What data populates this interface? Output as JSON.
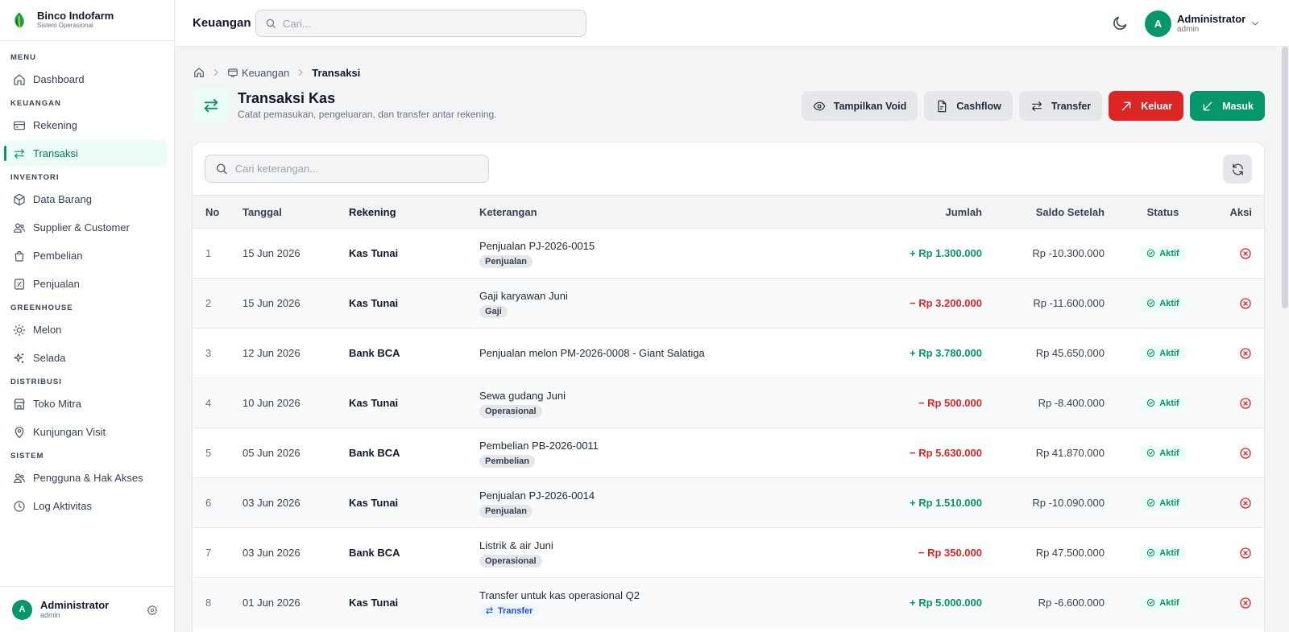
{
  "brand": {
    "name": "Binco Indofarm",
    "subtitle": "Sistem Operasional"
  },
  "sidebar": {
    "sections": [
      {
        "label": "MENU",
        "items": [
          {
            "label": "Dashboard",
            "icon": "home-icon"
          }
        ]
      },
      {
        "label": "KEUANGAN",
        "items": [
          {
            "label": "Rekening",
            "icon": "card-icon"
          },
          {
            "label": "Transaksi",
            "icon": "transfer-icon",
            "active": true
          }
        ]
      },
      {
        "label": "INVENTORI",
        "items": [
          {
            "label": "Data Barang",
            "icon": "box-icon"
          },
          {
            "label": "Supplier & Customer",
            "icon": "users-icon"
          },
          {
            "label": "Pembelian",
            "icon": "bag-icon"
          },
          {
            "label": "Penjualan",
            "icon": "receipt-icon"
          }
        ]
      },
      {
        "label": "GREENHOUSE",
        "items": [
          {
            "label": "Melon",
            "icon": "sun-icon"
          },
          {
            "label": "Selada",
            "icon": "sparkles-icon"
          }
        ]
      },
      {
        "label": "DISTRIBUSI",
        "items": [
          {
            "label": "Toko Mitra",
            "icon": "store-icon"
          },
          {
            "label": "Kunjungan Visit",
            "icon": "pin-icon"
          }
        ]
      },
      {
        "label": "SISTEM",
        "items": [
          {
            "label": "Pengguna & Hak Akses",
            "icon": "users-icon"
          },
          {
            "label": "Log Aktivitas",
            "icon": "clock-icon"
          }
        ]
      }
    ],
    "user": {
      "initial": "A",
      "name": "Administrator",
      "role": "admin"
    }
  },
  "topbar": {
    "title": "Keuangan",
    "search_placeholder": "Cari...",
    "user": {
      "initial": "A",
      "name": "Administrator",
      "role": "admin"
    }
  },
  "breadcrumb": {
    "parent": "Keuangan",
    "current": "Transaksi"
  },
  "page": {
    "title": "Transaksi Kas",
    "subtitle": "Catat pemasukan, pengeluaran, dan transfer antar rekening."
  },
  "actions": {
    "void": "Tampilkan Void",
    "cashflow": "Cashflow",
    "transfer": "Transfer",
    "keluar": "Keluar",
    "masuk": "Masuk"
  },
  "table": {
    "search_placeholder": "Cari keterangan...",
    "headers": {
      "no": "No",
      "tanggal": "Tanggal",
      "rekening": "Rekening",
      "keterangan": "Keterangan",
      "jumlah": "Jumlah",
      "saldo": "Saldo Setelah",
      "status": "Status",
      "aksi": "Aksi"
    },
    "rows": [
      {
        "no": "1",
        "tanggal": "15 Jun 2026",
        "rekening": "Kas Tunai",
        "keterangan": "Penjualan PJ-2026-0015",
        "tag": "Penjualan",
        "tag_type": "default",
        "jumlah": "+ Rp 1.300.000",
        "direction": "in",
        "saldo": "Rp -10.300.000",
        "status": "Aktif"
      },
      {
        "no": "2",
        "tanggal": "15 Jun 2026",
        "rekening": "Kas Tunai",
        "keterangan": "Gaji karyawan Juni",
        "tag": "Gaji",
        "tag_type": "default",
        "jumlah": "− Rp 3.200.000",
        "direction": "out",
        "saldo": "Rp -11.600.000",
        "status": "Aktif"
      },
      {
        "no": "3",
        "tanggal": "12 Jun 2026",
        "rekening": "Bank BCA",
        "keterangan": "Penjualan melon PM-2026-0008 - Giant Salatiga",
        "tag": "",
        "tag_type": "none",
        "jumlah": "+ Rp 3.780.000",
        "direction": "in",
        "saldo": "Rp 45.650.000",
        "status": "Aktif"
      },
      {
        "no": "4",
        "tanggal": "10 Jun 2026",
        "rekening": "Kas Tunai",
        "keterangan": "Sewa gudang Juni",
        "tag": "Operasional",
        "tag_type": "default",
        "jumlah": "− Rp 500.000",
        "direction": "out",
        "saldo": "Rp -8.400.000",
        "status": "Aktif"
      },
      {
        "no": "5",
        "tanggal": "05 Jun 2026",
        "rekening": "Bank BCA",
        "keterangan": "Pembelian PB-2026-0011",
        "tag": "Pembelian",
        "tag_type": "default",
        "jumlah": "− Rp 5.630.000",
        "direction": "out",
        "saldo": "Rp 41.870.000",
        "status": "Aktif"
      },
      {
        "no": "6",
        "tanggal": "03 Jun 2026",
        "rekening": "Kas Tunai",
        "keterangan": "Penjualan PJ-2026-0014",
        "tag": "Penjualan",
        "tag_type": "default",
        "jumlah": "+ Rp 1.510.000",
        "direction": "in",
        "saldo": "Rp -10.090.000",
        "status": "Aktif"
      },
      {
        "no": "7",
        "tanggal": "03 Jun 2026",
        "rekening": "Bank BCA",
        "keterangan": "Listrik & air Juni",
        "tag": "Operasional",
        "tag_type": "default",
        "jumlah": "− Rp 350.000",
        "direction": "out",
        "saldo": "Rp 47.500.000",
        "status": "Aktif"
      },
      {
        "no": "8",
        "tanggal": "01 Jun 2026",
        "rekening": "Kas Tunai",
        "keterangan": "Transfer untuk kas operasional Q2",
        "tag": "Transfer",
        "tag_type": "transfer",
        "jumlah": "+ Rp 5.000.000",
        "direction": "in",
        "saldo": "Rp -6.600.000",
        "status": "Aktif"
      }
    ]
  },
  "colors": {
    "accent": "#059669",
    "danger": "#dc2626",
    "positive": "#059669",
    "negative": "#dc2626"
  }
}
